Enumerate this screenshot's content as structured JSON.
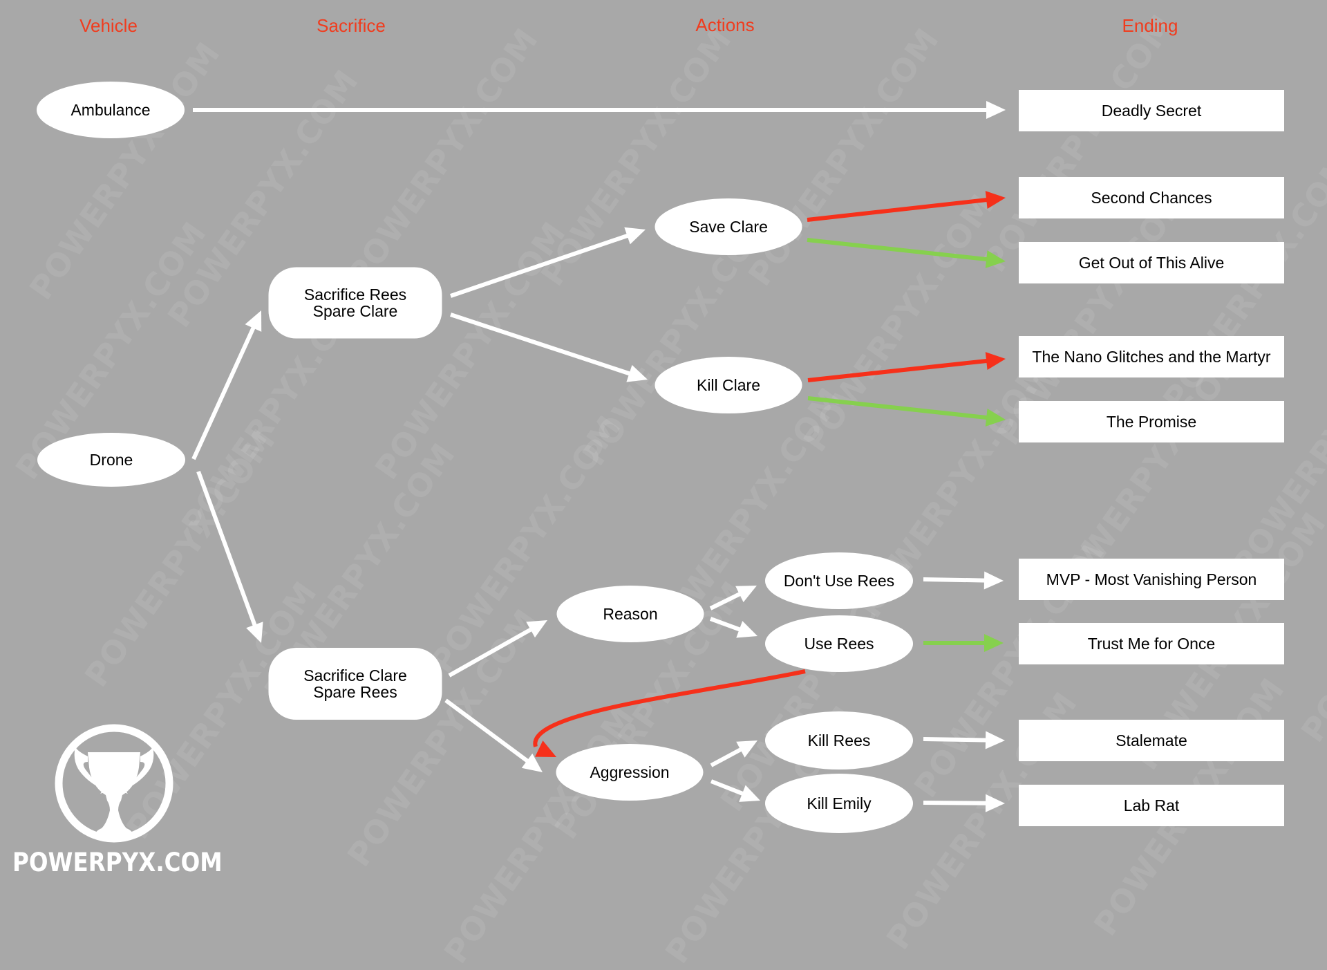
{
  "colors": {
    "background": "#a8a8a8",
    "header": "#f03c1e",
    "node_fill": "#ffffff",
    "edge_default": "#ffffff",
    "edge_red": "#f6301a",
    "edge_green": "#86d04e"
  },
  "columns": [
    {
      "id": "vehicle",
      "label": "Vehicle"
    },
    {
      "id": "sacrifice",
      "label": "Sacrifice"
    },
    {
      "id": "actions",
      "label": "Actions"
    },
    {
      "id": "ending",
      "label": "Ending"
    }
  ],
  "nodes": [
    {
      "id": "ambulance",
      "shape": "ellipse",
      "lines": [
        "Ambulance"
      ]
    },
    {
      "id": "drone",
      "shape": "ellipse",
      "lines": [
        "Drone"
      ]
    },
    {
      "id": "sacrifice-rees",
      "shape": "rounded",
      "lines": [
        "Sacrifice Rees",
        "Spare Clare"
      ]
    },
    {
      "id": "sacrifice-clare",
      "shape": "rounded",
      "lines": [
        "Sacrifice Clare",
        "Spare Rees"
      ]
    },
    {
      "id": "save-clare",
      "shape": "ellipse",
      "lines": [
        "Save Clare"
      ]
    },
    {
      "id": "kill-clare",
      "shape": "ellipse",
      "lines": [
        "Kill Clare"
      ]
    },
    {
      "id": "reason",
      "shape": "ellipse",
      "lines": [
        "Reason"
      ]
    },
    {
      "id": "aggression",
      "shape": "ellipse",
      "lines": [
        "Aggression"
      ]
    },
    {
      "id": "dont-use-rees",
      "shape": "ellipse",
      "lines": [
        "Don't Use Rees"
      ]
    },
    {
      "id": "use-rees",
      "shape": "ellipse",
      "lines": [
        "Use Rees"
      ]
    },
    {
      "id": "kill-rees",
      "shape": "ellipse",
      "lines": [
        "Kill Rees"
      ]
    },
    {
      "id": "kill-emily",
      "shape": "ellipse",
      "lines": [
        "Kill Emily"
      ]
    },
    {
      "id": "deadly-secret",
      "shape": "rect",
      "lines": [
        "Deadly Secret"
      ]
    },
    {
      "id": "second-chances",
      "shape": "rect",
      "lines": [
        "Second Chances"
      ]
    },
    {
      "id": "get-out-of-this-alive",
      "shape": "rect",
      "lines": [
        "Get Out of This Alive"
      ]
    },
    {
      "id": "nano-glitches-martyr",
      "shape": "rect",
      "lines": [
        "The Nano Glitches and the Martyr"
      ]
    },
    {
      "id": "the-promise",
      "shape": "rect",
      "lines": [
        "The Promise"
      ]
    },
    {
      "id": "mvp",
      "shape": "rect",
      "lines": [
        "MVP - Most Vanishing Person"
      ]
    },
    {
      "id": "trust-me-for-once",
      "shape": "rect",
      "lines": [
        "Trust Me for Once"
      ]
    },
    {
      "id": "stalemate",
      "shape": "rect",
      "lines": [
        "Stalemate"
      ]
    },
    {
      "id": "lab-rat",
      "shape": "rect",
      "lines": [
        "Lab Rat"
      ]
    }
  ],
  "edges": [
    {
      "from": "ambulance",
      "to": "deadly-secret",
      "color": "white"
    },
    {
      "from": "drone",
      "to": "sacrifice-rees",
      "color": "white"
    },
    {
      "from": "drone",
      "to": "sacrifice-clare",
      "color": "white"
    },
    {
      "from": "sacrifice-rees",
      "to": "save-clare",
      "color": "white"
    },
    {
      "from": "sacrifice-rees",
      "to": "kill-clare",
      "color": "white"
    },
    {
      "from": "save-clare",
      "to": "second-chances",
      "color": "red"
    },
    {
      "from": "save-clare",
      "to": "get-out-of-this-alive",
      "color": "green"
    },
    {
      "from": "kill-clare",
      "to": "nano-glitches-martyr",
      "color": "red"
    },
    {
      "from": "kill-clare",
      "to": "the-promise",
      "color": "green"
    },
    {
      "from": "sacrifice-clare",
      "to": "reason",
      "color": "white"
    },
    {
      "from": "sacrifice-clare",
      "to": "aggression",
      "color": "white"
    },
    {
      "from": "reason",
      "to": "dont-use-rees",
      "color": "white"
    },
    {
      "from": "reason",
      "to": "use-rees",
      "color": "white"
    },
    {
      "from": "dont-use-rees",
      "to": "mvp",
      "color": "white"
    },
    {
      "from": "use-rees",
      "to": "trust-me-for-once",
      "color": "green"
    },
    {
      "from": "use-rees",
      "to": "aggression",
      "color": "red"
    },
    {
      "from": "aggression",
      "to": "kill-rees",
      "color": "white"
    },
    {
      "from": "aggression",
      "to": "kill-emily",
      "color": "white"
    },
    {
      "from": "kill-rees",
      "to": "stalemate",
      "color": "white"
    },
    {
      "from": "kill-emily",
      "to": "lab-rat",
      "color": "white"
    }
  ],
  "watermark": "POWERPYX.COM",
  "logo": {
    "text": "POWERPYX.COM",
    "icon": "trophy-icon"
  }
}
